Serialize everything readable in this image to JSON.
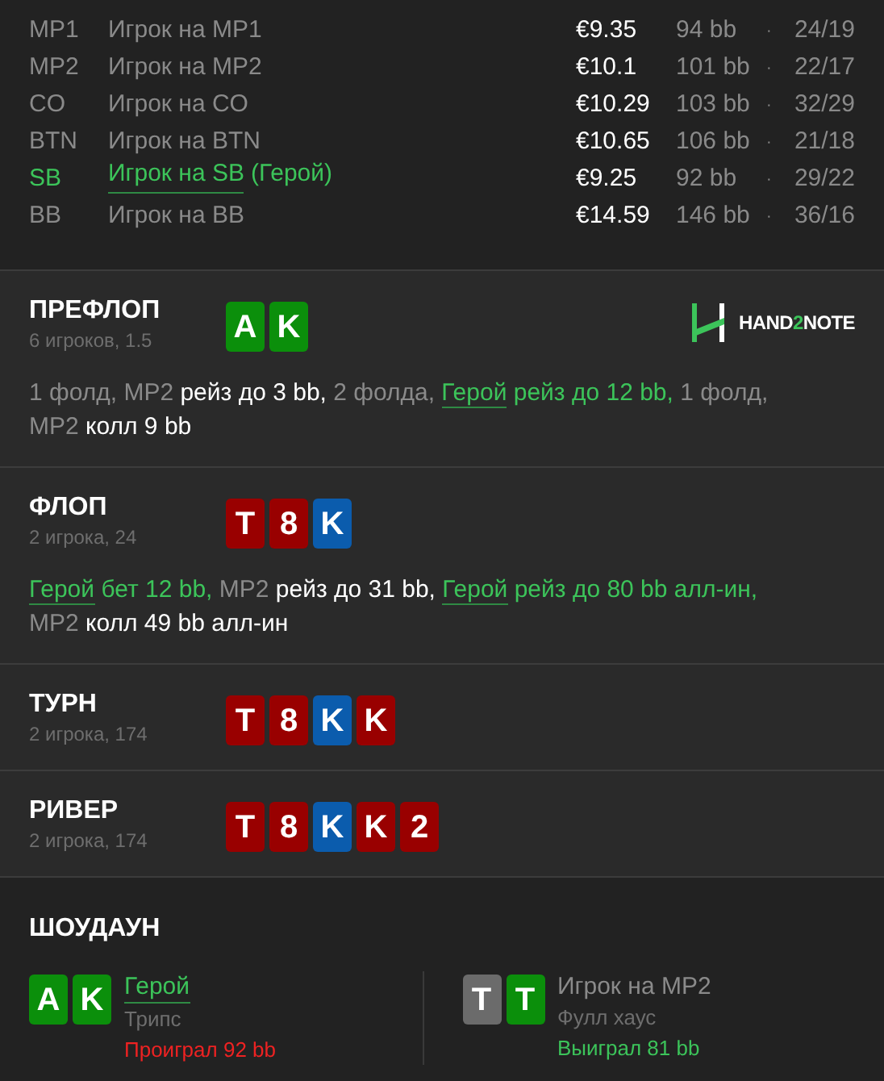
{
  "players": [
    {
      "position": "MP1",
      "name": "Игрок на MP1",
      "hero": false,
      "stack": "€9.35",
      "bb": "94 bb",
      "dot": "·",
      "stats": "24/19"
    },
    {
      "position": "MP2",
      "name": "Игрок на MP2",
      "hero": false,
      "stack": "€10.1",
      "bb": "101 bb",
      "dot": "·",
      "stats": "22/17"
    },
    {
      "position": "CO",
      "name": "Игрок на CO",
      "hero": false,
      "stack": "€10.29",
      "bb": "103 bb",
      "dot": "·",
      "stats": "32/29"
    },
    {
      "position": "BTN",
      "name": "Игрок на BTN",
      "hero": false,
      "stack": "€10.65",
      "bb": "106 bb",
      "dot": "·",
      "stats": "21/18"
    },
    {
      "position": "SB",
      "name": "Игрок на SB",
      "note": "(Герой)",
      "hero": true,
      "stack": "€9.25",
      "bb": "92 bb",
      "dot": "·",
      "stats": "29/22"
    },
    {
      "position": "BB",
      "name": "Игрок на BB",
      "hero": false,
      "stack": "€14.59",
      "bb": "146 bb",
      "dot": "·",
      "stats": "36/16"
    }
  ],
  "streets": [
    {
      "title": "ПРЕФЛОП",
      "subtitle": "6 игроков, 1.5",
      "logo": {
        "before": "HAND",
        "accent": "2",
        "after": "NOTE"
      },
      "cards": [
        {
          "rank": "A",
          "color": "#0b8f0b"
        },
        {
          "rank": "K",
          "color": "#0b8f0b"
        }
      ],
      "actions": [
        [
          {
            "kind": "neutral",
            "text": "1 фолд, MP2 "
          },
          {
            "kind": "strong",
            "text": "рейз до 3 bb, "
          },
          {
            "kind": "neutral",
            "text": "2 фолда, "
          },
          {
            "kind": "hero-link",
            "text": "Герой"
          },
          {
            "kind": "hero",
            "text": " рейз до 12 bb, "
          },
          {
            "kind": "neutral",
            "text": "1 фолд,"
          }
        ],
        [
          {
            "kind": "neutral",
            "text": "MP2 "
          },
          {
            "kind": "strong",
            "text": "колл 9 bb"
          }
        ]
      ]
    },
    {
      "title": "ФЛОП",
      "subtitle": "2 игрока, 24",
      "cards": [
        {
          "rank": "T",
          "color": "#990000"
        },
        {
          "rank": "8",
          "color": "#990000"
        },
        {
          "rank": "K",
          "color": "#0b5cad"
        }
      ],
      "actions": [
        [
          {
            "kind": "hero-link",
            "text": "Герой"
          },
          {
            "kind": "hero",
            "text": " бет 12 bb, "
          },
          {
            "kind": "neutral",
            "text": "MP2 "
          },
          {
            "kind": "strong",
            "text": "рейз до 31 bb, "
          },
          {
            "kind": "hero-link",
            "text": "Герой"
          },
          {
            "kind": "hero",
            "text": " рейз до 80 bb алл-ин,"
          }
        ],
        [
          {
            "kind": "neutral",
            "text": "MP2 "
          },
          {
            "kind": "strong",
            "text": "колл 49 bb алл-ин"
          }
        ]
      ]
    },
    {
      "title": "ТУРН",
      "subtitle": "2 игрока, 174",
      "cards": [
        {
          "rank": "T",
          "color": "#990000"
        },
        {
          "rank": "8",
          "color": "#990000"
        },
        {
          "rank": "K",
          "color": "#0b5cad"
        },
        {
          "rank": "K",
          "color": "#990000"
        }
      ]
    },
    {
      "title": "РИВЕР",
      "subtitle": "2 игрока, 174",
      "cards": [
        {
          "rank": "T",
          "color": "#990000"
        },
        {
          "rank": "8",
          "color": "#990000"
        },
        {
          "rank": "K",
          "color": "#0b5cad"
        },
        {
          "rank": "K",
          "color": "#990000"
        },
        {
          "rank": "2",
          "color": "#990000"
        }
      ]
    }
  ],
  "showdown": {
    "title": "ШОУДАУН",
    "players": [
      {
        "name": "Герой",
        "hero": true,
        "hand": "Трипс",
        "result": "Проиграл 92 bb",
        "won": false,
        "cards": [
          {
            "rank": "A",
            "color": "#0b8f0b"
          },
          {
            "rank": "K",
            "color": "#0b8f0b"
          }
        ]
      },
      {
        "name": "Игрок на MP2",
        "hero": false,
        "hand": "Фулл хаус",
        "result": "Выиграл 81 bb",
        "won": true,
        "cards": [
          {
            "rank": "T",
            "color": "#6b6b6b"
          },
          {
            "rank": "T",
            "color": "#0b8f0b"
          }
        ]
      }
    ]
  }
}
